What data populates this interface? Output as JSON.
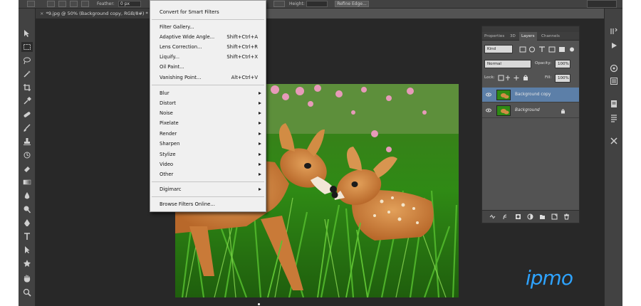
{
  "options_bar": {
    "feather_label": "Feather:",
    "feather_value": "0 px",
    "height_label": "Height:",
    "refine_edge": "Refine Edge..."
  },
  "document": {
    "tab_title": "*9.jpg @ 50% (Background copy, RGB/8#) *",
    "close_glyph": "×"
  },
  "filter_menu": {
    "items": [
      {
        "label": "Convert for Smart Filters",
        "shortcut": ""
      },
      {
        "label": "Filter Gallery...",
        "shortcut": ""
      },
      {
        "label": "Adaptive Wide Angle...",
        "shortcut": "Shift+Ctrl+A"
      },
      {
        "label": "Lens Correction...",
        "shortcut": "Shift+Ctrl+R"
      },
      {
        "label": "Liquify...",
        "shortcut": "Shift+Ctrl+X"
      },
      {
        "label": "Oil Paint...",
        "shortcut": ""
      },
      {
        "label": "Vanishing Point...",
        "shortcut": "Alt+Ctrl+V"
      },
      {
        "label": "Blur",
        "submenu": true
      },
      {
        "label": "Distort",
        "submenu": true
      },
      {
        "label": "Noise",
        "submenu": true
      },
      {
        "label": "Pixelate",
        "submenu": true
      },
      {
        "label": "Render",
        "submenu": true
      },
      {
        "label": "Sharpen",
        "submenu": true
      },
      {
        "label": "Stylize",
        "submenu": true
      },
      {
        "label": "Video",
        "submenu": true
      },
      {
        "label": "Other",
        "submenu": true
      },
      {
        "label": "Digimarc",
        "submenu": true
      },
      {
        "label": "Browse Filters Online...",
        "shortcut": ""
      }
    ]
  },
  "layers_panel": {
    "tabs": [
      "Properties",
      "3D",
      "Layers",
      "Channels"
    ],
    "active_tab": "Layers",
    "filter_kind": "Kind",
    "blend_mode": "Normal",
    "opacity_label": "Opacity:",
    "opacity_value": "100%",
    "lock_label": "Lock:",
    "fill_label": "Fill:",
    "fill_value": "100%",
    "layers": [
      {
        "name": "Background copy",
        "selected": true
      },
      {
        "name": "Background",
        "selected": false,
        "locked": true
      }
    ]
  },
  "watermark": {
    "text": "ipmo"
  },
  "colors": {
    "ui_dark": "#535353",
    "panel_dark": "#424242",
    "canvas_bg": "#282828",
    "menu_bg": "#f0f0f0",
    "selected_layer": "#5c7fa8",
    "logo_blue": "#2ea3ff"
  }
}
